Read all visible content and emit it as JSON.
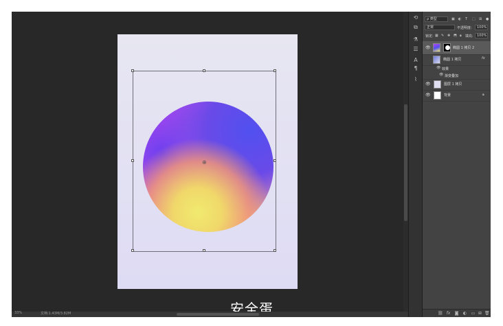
{
  "canvas": {
    "subtitle": "安全蛋"
  },
  "status": {
    "zoom": "33%",
    "doc_size": "文档:1.43M/3.82M"
  },
  "layers_panel": {
    "filter_kind": "ρ 类型",
    "blend_mode": "正常",
    "opacity_label": "不透明度:",
    "opacity_value": "100%",
    "lock_label": "锁定:",
    "fill_label": "填充:",
    "fill_value": "100%",
    "layers": [
      {
        "name": "椭圆 1 拷贝 2",
        "selected": true
      },
      {
        "name": "椭圆 1 拷贝",
        "fx": "fx"
      },
      {
        "name": "效果",
        "effect": true
      },
      {
        "name": "渐变叠加",
        "effect": true
      },
      {
        "name": "图层 1 拷贝"
      },
      {
        "name": "背景"
      }
    ]
  },
  "tools": [
    "history-icon",
    "properties-icon",
    "adjust-icon",
    "character-icon",
    "paragraph-icon",
    "brush-icon",
    "swatches-icon"
  ],
  "colors": {
    "workspace": "#282828",
    "panel": "#434343",
    "orb_yellow": "#f1ea6f",
    "orb_blue": "#5150f0",
    "orb_purple": "#b044f0"
  }
}
